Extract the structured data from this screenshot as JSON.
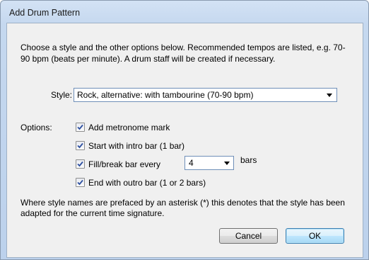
{
  "window": {
    "title": "Add Drum Pattern"
  },
  "description": "Choose a style and the other options below. Recommended tempos are listed, e.g. 70-90 bpm (beats per minute). A drum staff will be created if necessary.",
  "style": {
    "label": "Style:",
    "selected": "Rock, alternative: with tambourine (70-90 bpm)"
  },
  "options": {
    "label": "Options:",
    "add_metronome": {
      "label": "Add metronome mark",
      "checked": true
    },
    "intro_bar": {
      "label": "Start with intro bar (1 bar)",
      "checked": true
    },
    "fill_break": {
      "label": "Fill/break bar every",
      "checked": true,
      "value": "4",
      "unit": "bars"
    },
    "outro_bar": {
      "label": "End with outro bar (1 or 2 bars)",
      "checked": true
    }
  },
  "note": "Where style names are prefaced by an asterisk (*) this denotes that the style has been adapted for the current time signature.",
  "buttons": {
    "cancel": "Cancel",
    "ok": "OK"
  }
}
